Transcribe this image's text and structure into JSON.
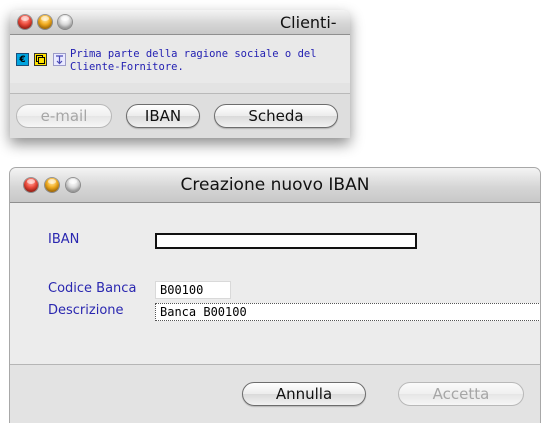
{
  "clienti_window": {
    "title": "Clienti-",
    "icons": [
      "euro-icon",
      "note-icon",
      "sort-icon"
    ],
    "euro_symbol": "€",
    "description_line1": "Prima parte della ragione sociale o del",
    "description_line2": "Cliente-Fornitore.",
    "buttons": {
      "email": "e-mail",
      "iban": "IBAN",
      "scheda": "Scheda"
    }
  },
  "iban_dialog": {
    "title": "Creazione nuovo IBAN",
    "fields": {
      "iban_label": "IBAN",
      "iban_value": "",
      "codice_banca_label": "Codice Banca",
      "codice_banca_value": "B00100",
      "descrizione_label": "Descrizione",
      "descrizione_value": "Banca B00100"
    },
    "buttons": {
      "annulla": "Annulla",
      "accetta": "Accetta"
    }
  },
  "colors": {
    "label_blue": "#2a27b0",
    "description_blue": "#2421b2",
    "euro_icon_bg": "#00a5e0",
    "note_icon_bg": "#ffe200"
  }
}
